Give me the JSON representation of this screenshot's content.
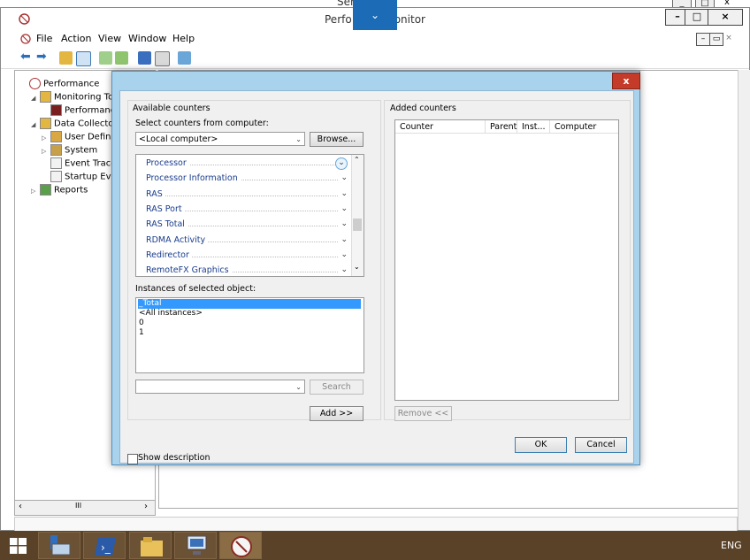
{
  "background_window": {
    "title_fragment": "Ser        ger"
  },
  "window": {
    "title_left": "Perfo",
    "title_right": "onitor",
    "blue_tab_icon": "chevron-down-icon",
    "controls": [
      "–",
      "□",
      "×"
    ],
    "mdi_controls": [
      "–",
      "▭",
      "×"
    ]
  },
  "menu": {
    "items": [
      "File",
      "Action",
      "View",
      "Window",
      "Help"
    ]
  },
  "tree": {
    "items": [
      {
        "label": "Performance",
        "indent": 0,
        "expander": "",
        "icon": "perfmon-icon"
      },
      {
        "label": "Monitoring Too",
        "indent": 1,
        "expander": "◢",
        "icon": "folder-icon"
      },
      {
        "label": "Performance",
        "indent": 2,
        "expander": "",
        "icon": "chart-icon"
      },
      {
        "label": "Data Collector S",
        "indent": 1,
        "expander": "◢",
        "icon": "folder-icon"
      },
      {
        "label": "User Defined",
        "indent": 2,
        "expander": "▷",
        "icon": "folder-user-icon"
      },
      {
        "label": "System",
        "indent": 2,
        "expander": "▷",
        "icon": "folder-system-icon"
      },
      {
        "label": "Event Trace S",
        "indent": 2,
        "expander": "",
        "icon": "document-icon"
      },
      {
        "label": "Startup Even",
        "indent": 2,
        "expander": "",
        "icon": "document-icon"
      },
      {
        "label": "Reports",
        "indent": 1,
        "expander": "▷",
        "icon": "reports-icon"
      }
    ],
    "scroll_thumb": "III"
  },
  "dialog": {
    "close_label": "x",
    "available_counters_label": "Available counters",
    "select_computer_label": "Select counters from computer:",
    "computer_value": "<Local computer>",
    "browse_label": "Browse...",
    "counters": [
      {
        "label": "Processor",
        "selected": true
      },
      {
        "label": "Processor Information",
        "selected": false
      },
      {
        "label": "RAS",
        "selected": false
      },
      {
        "label": "RAS Port",
        "selected": false
      },
      {
        "label": "RAS Total",
        "selected": false
      },
      {
        "label": "RDMA Activity",
        "selected": false
      },
      {
        "label": "Redirector",
        "selected": false
      },
      {
        "label": "RemoteFX Graphics",
        "selected": false
      }
    ],
    "instances_label": "Instances of selected object:",
    "instances": [
      {
        "label": "_Total",
        "selected": true
      },
      {
        "label": "<All instances>",
        "selected": false
      },
      {
        "label": "0",
        "selected": false
      },
      {
        "label": "1",
        "selected": false
      }
    ],
    "search_value": "",
    "search_label": "Search",
    "add_label": "Add >>",
    "added_counters_label": "Added counters",
    "added_columns": [
      "Counter",
      "Parent",
      "Inst...",
      "Computer"
    ],
    "remove_label": "Remove <<",
    "show_description_label": "Show description",
    "ok_label": "OK",
    "cancel_label": "Cancel"
  },
  "taskbar": {
    "items": [
      "windows-start-icon",
      "server-manager-icon",
      "powershell-icon",
      "file-explorer-icon",
      "remote-desktop-icon",
      "perfmon-icon"
    ],
    "language": "ENG"
  }
}
